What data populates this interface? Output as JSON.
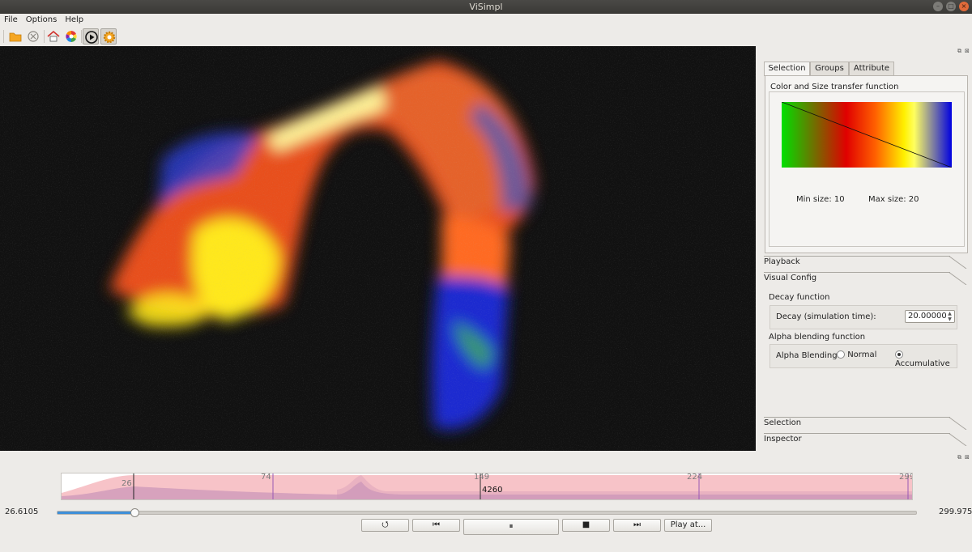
{
  "window": {
    "title": "ViSimpl"
  },
  "menu": {
    "file": "File",
    "options": "Options",
    "help": "Help"
  },
  "toolbar": {
    "open": "folder-open-icon",
    "close": "close-circle-icon",
    "home": "home-icon",
    "color": "color-wheel-icon",
    "play": "play-circle-icon",
    "config": "gear-icon"
  },
  "panel": {
    "tabs": [
      {
        "label": "Selection"
      },
      {
        "label": "Groups"
      },
      {
        "label": "Attribute"
      }
    ],
    "tf_title": "Color and Size transfer function",
    "min_size_label": "Min size: 10",
    "max_size_label": "Max size: 20",
    "sections": {
      "playback": "Playback",
      "visual_config": "Visual Config",
      "selection": "Selection",
      "inspector": "Inspector"
    },
    "decay": {
      "group_title": "Decay function",
      "label": "Decay (simulation time):",
      "value": "20.00000"
    },
    "alpha": {
      "group_title": "Alpha blending function",
      "label": "Alpha Blending:",
      "normal": "Normal",
      "accumulative": "Accumulative",
      "selected": "accumulative"
    }
  },
  "timeline": {
    "markers": [
      "26",
      "74",
      "149",
      "224",
      "299"
    ],
    "cursor_value": "4260",
    "start_label": "26.6105",
    "end_label": "299.975",
    "slider_fraction": 0.09
  },
  "playback_buttons": {
    "restart": "restart-icon",
    "prev": "skip-back-icon",
    "pause": "pause-icon",
    "stop": "stop-icon",
    "next": "skip-forward-icon",
    "play_at": "Play at..."
  },
  "colors": {
    "accent": "#3f8fd8",
    "timeline_fill": "#f7c3c8"
  }
}
